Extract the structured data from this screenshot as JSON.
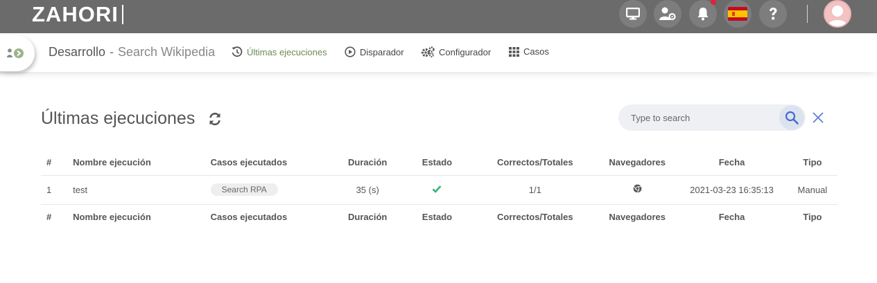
{
  "header": {
    "logo": "ZAHORI",
    "icons": [
      "monitor-icon",
      "user-settings-icon",
      "bell-icon",
      "spain-flag-icon",
      "help-icon"
    ],
    "colors": {
      "bar": "#6b6b6b",
      "notification": "#e0223a"
    }
  },
  "subnav": {
    "project": "Desarrollo",
    "separator": "-",
    "process": "Search Wikipedia",
    "links": [
      {
        "label": "Últimas ejecuciones",
        "icon": "history-icon",
        "active": true
      },
      {
        "label": "Disparador",
        "icon": "play-circle-icon",
        "active": false
      },
      {
        "label": "Configurador",
        "icon": "gears-icon",
        "active": false
      },
      {
        "label": "Casos",
        "icon": "grid-icon",
        "active": false
      }
    ],
    "accent": "#6c8a55"
  },
  "main": {
    "title": "Últimas ejecuciones",
    "search_placeholder": "Type to search"
  },
  "table": {
    "columns": [
      "#",
      "Nombre ejecución",
      "Casos ejecutados",
      "Duración",
      "Estado",
      "Correctos/Totales",
      "Navegadores",
      "Fecha",
      "Tipo"
    ],
    "rows": [
      {
        "num": "1",
        "name": "test",
        "case": "Search RPA",
        "duration": "35 (s)",
        "status": "ok",
        "correct": "1/1",
        "browser": "chrome-icon",
        "date": "2021-03-23 16:35:13",
        "type": "Manual"
      }
    ]
  }
}
